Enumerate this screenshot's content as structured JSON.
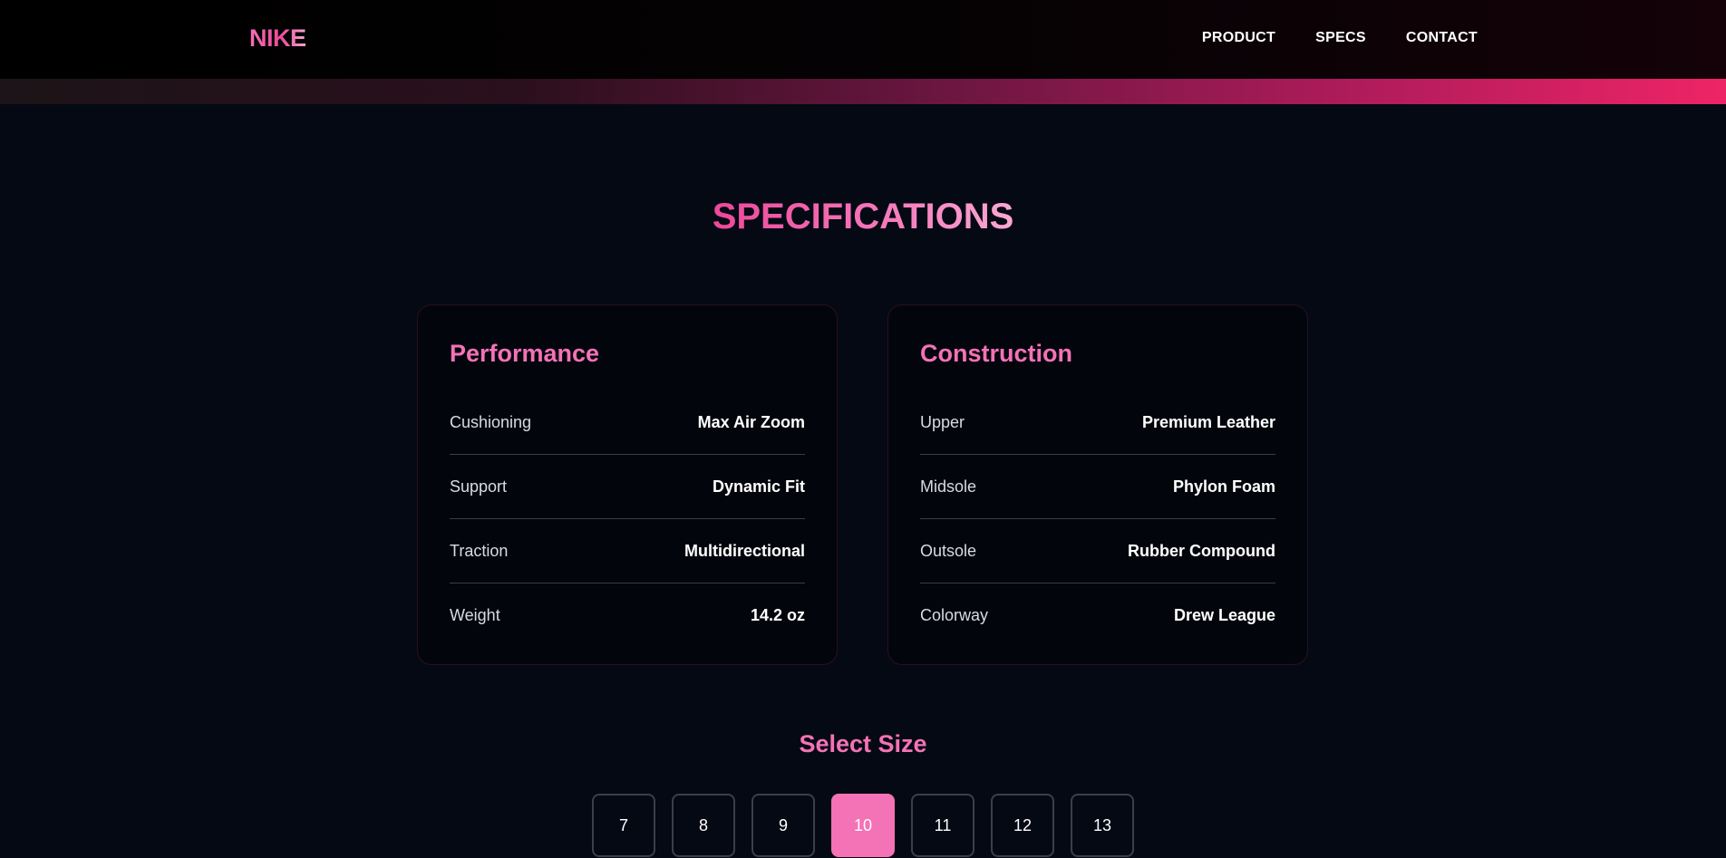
{
  "header": {
    "logo": "NIKE",
    "nav": [
      {
        "label": "PRODUCT"
      },
      {
        "label": "SPECS"
      },
      {
        "label": "CONTACT"
      }
    ]
  },
  "specs": {
    "title": "SPECIFICATIONS",
    "performance": {
      "title": "Performance",
      "rows": [
        {
          "label": "Cushioning",
          "value": "Max Air Zoom"
        },
        {
          "label": "Support",
          "value": "Dynamic Fit"
        },
        {
          "label": "Traction",
          "value": "Multidirectional"
        },
        {
          "label": "Weight",
          "value": "14.2 oz"
        }
      ]
    },
    "construction": {
      "title": "Construction",
      "rows": [
        {
          "label": "Upper",
          "value": "Premium Leather"
        },
        {
          "label": "Midsole",
          "value": "Phylon Foam"
        },
        {
          "label": "Outsole",
          "value": "Rubber Compound"
        },
        {
          "label": "Colorway",
          "value": "Drew League"
        }
      ]
    }
  },
  "size_selector": {
    "title": "Select Size",
    "sizes": [
      "7",
      "8",
      "9",
      "10",
      "11",
      "12",
      "13"
    ],
    "selected": "10"
  },
  "colors": {
    "accent": "#f472b6",
    "background": "#050913"
  }
}
